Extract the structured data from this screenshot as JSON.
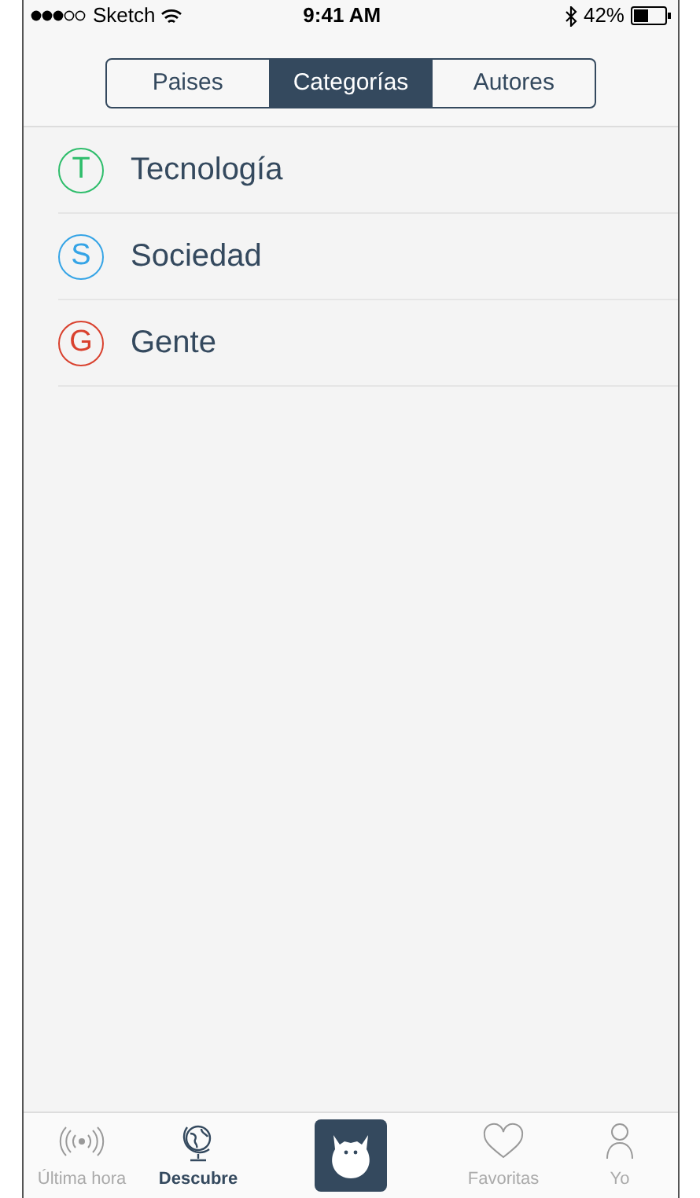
{
  "status_bar": {
    "carrier": "Sketch",
    "time": "9:41 AM",
    "battery": "42%"
  },
  "segments": [
    {
      "label": "Paises",
      "selected": false
    },
    {
      "label": "Categorías",
      "selected": true
    },
    {
      "label": "Autores",
      "selected": false
    }
  ],
  "categories": [
    {
      "letter": "T",
      "name": "Tecnología",
      "color": "#2ebd6b"
    },
    {
      "letter": "S",
      "name": "Sociedad",
      "color": "#35a4e6"
    },
    {
      "letter": "G",
      "name": "Gente",
      "color": "#d9412e"
    }
  ],
  "tab_bar": [
    {
      "kind": "radio",
      "label": "Última hora",
      "selected": false
    },
    {
      "kind": "globe",
      "label": "Descubre",
      "selected": true
    },
    {
      "kind": "logo"
    },
    {
      "kind": "heart",
      "label": "Favoritas",
      "selected": false
    },
    {
      "kind": "person",
      "label": "Yo",
      "selected": false
    }
  ]
}
